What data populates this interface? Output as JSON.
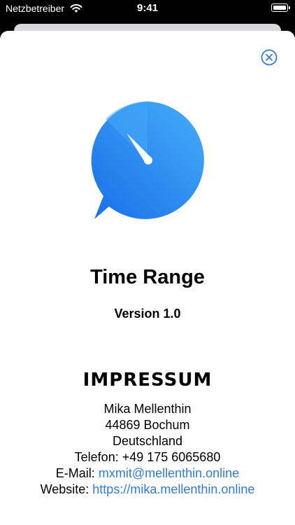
{
  "status_bar": {
    "carrier": "Netzbetreiber",
    "time": "9:41",
    "wifi_icon": "wifi-icon",
    "battery_icon": "battery-icon"
  },
  "sheet": {
    "close_icon": "close-circle-icon",
    "logo_icon": "speech-bubble-clock-logo"
  },
  "app": {
    "title": "Time Range",
    "version": "Version 1.0"
  },
  "impressum": {
    "heading": "IMPRESSUM",
    "name": "Mika Mellenthin",
    "city": "44869 Bochum",
    "country": "Deutschland",
    "phone": "Telefon: +49 175 6065680",
    "email_label": "E-Mail:",
    "email": "mxmit@mellenthin.online",
    "website_label": "Website:",
    "website": "https://mika.mellenthin.online"
  },
  "colors": {
    "accent": "#2f7ad9",
    "logo_light": "#42a5f8",
    "logo_dark": "#1a6fe8"
  }
}
